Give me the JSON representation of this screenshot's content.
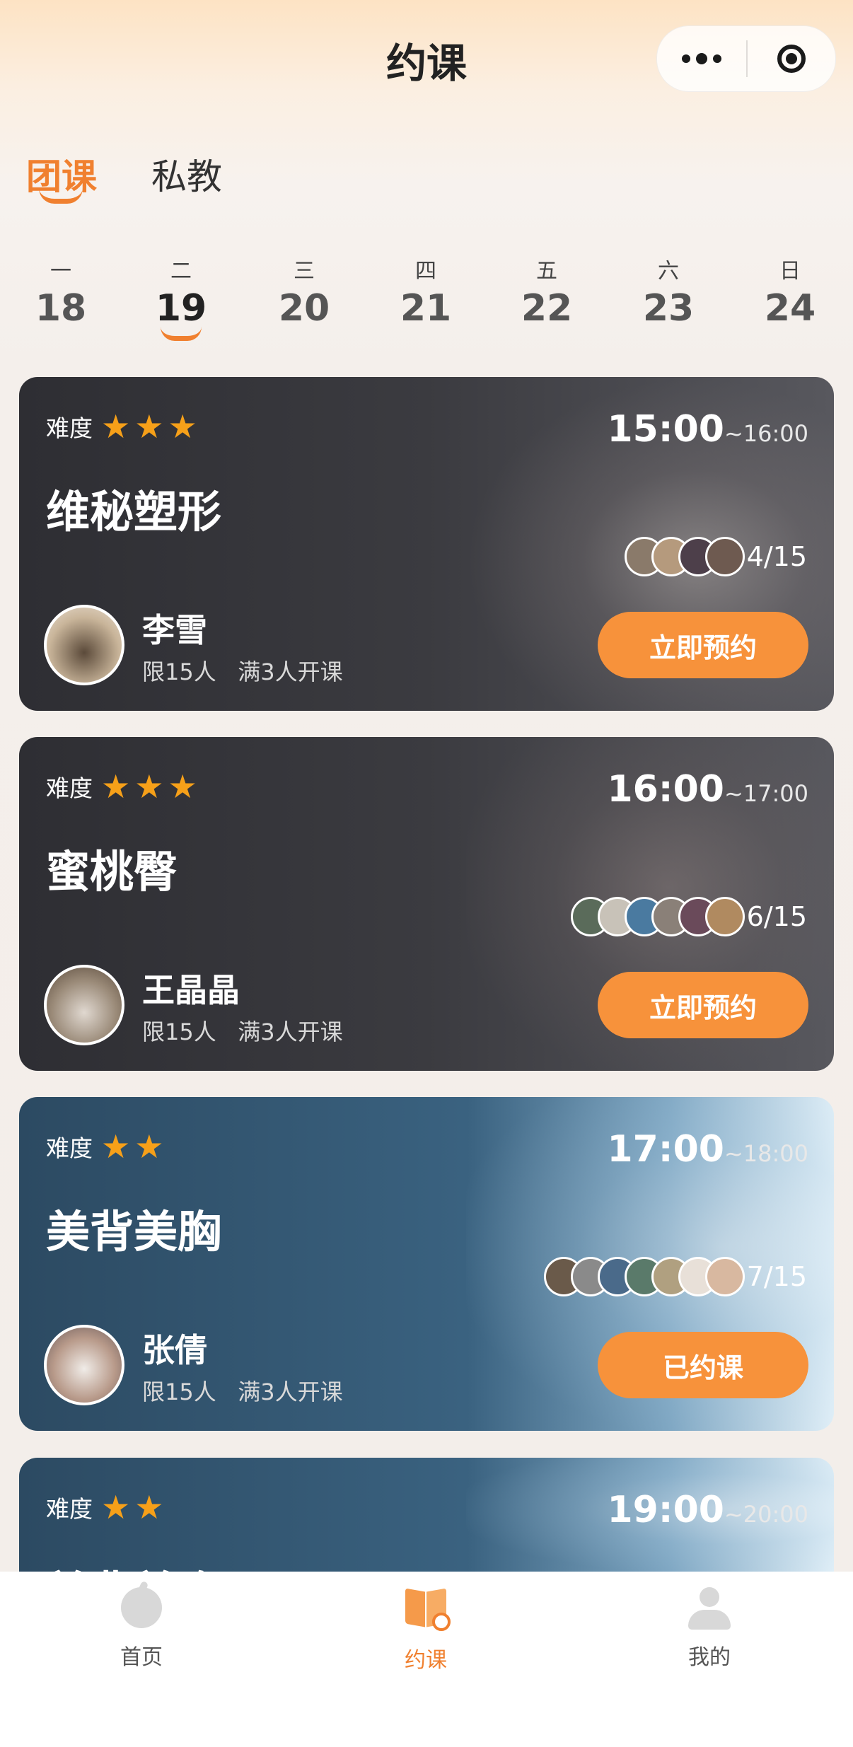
{
  "header": {
    "title": "约课"
  },
  "tabs": [
    {
      "label": "团课",
      "active": true
    },
    {
      "label": "私教",
      "active": false
    }
  ],
  "week": [
    {
      "weekday": "一",
      "date": "18",
      "active": false
    },
    {
      "weekday": "二",
      "date": "19",
      "active": true
    },
    {
      "weekday": "三",
      "date": "20",
      "active": false
    },
    {
      "weekday": "四",
      "date": "21",
      "active": false
    },
    {
      "weekday": "五",
      "date": "22",
      "active": false
    },
    {
      "weekday": "六",
      "date": "23",
      "active": false
    },
    {
      "weekday": "日",
      "date": "24",
      "active": false
    }
  ],
  "difficulty_label": "难度",
  "courses": [
    {
      "name": "维秘塑形",
      "stars": 3,
      "start": "15:00",
      "end": "~16:00",
      "booked": "4/15",
      "coach": "李雪",
      "limit": "限15人",
      "min": "满3人开课",
      "action": "立即预约",
      "attendee_avatars": 4
    },
    {
      "name": "蜜桃臀",
      "stars": 3,
      "start": "16:00",
      "end": "~17:00",
      "booked": "6/15",
      "coach": "王晶晶",
      "limit": "限15人",
      "min": "满3人开课",
      "action": "立即预约",
      "attendee_avatars": 6
    },
    {
      "name": "美背美胸",
      "stars": 2,
      "start": "17:00",
      "end": "~18:00",
      "booked": "7/15",
      "coach": "张倩",
      "limit": "限15人",
      "min": "满3人开课",
      "action": "已约课",
      "attendee_avatars": 7
    },
    {
      "name": "美背美胸",
      "stars": 2,
      "start": "19:00",
      "end": "~20:00"
    }
  ],
  "tabbar": [
    {
      "label": "首页",
      "icon": "home-icon",
      "active": false
    },
    {
      "label": "约课",
      "icon": "booking-icon",
      "active": true
    },
    {
      "label": "我的",
      "icon": "profile-icon",
      "active": false
    }
  ],
  "colors": {
    "accent": "#f0802f",
    "button": "#f7923b",
    "star": "#f6a019"
  }
}
